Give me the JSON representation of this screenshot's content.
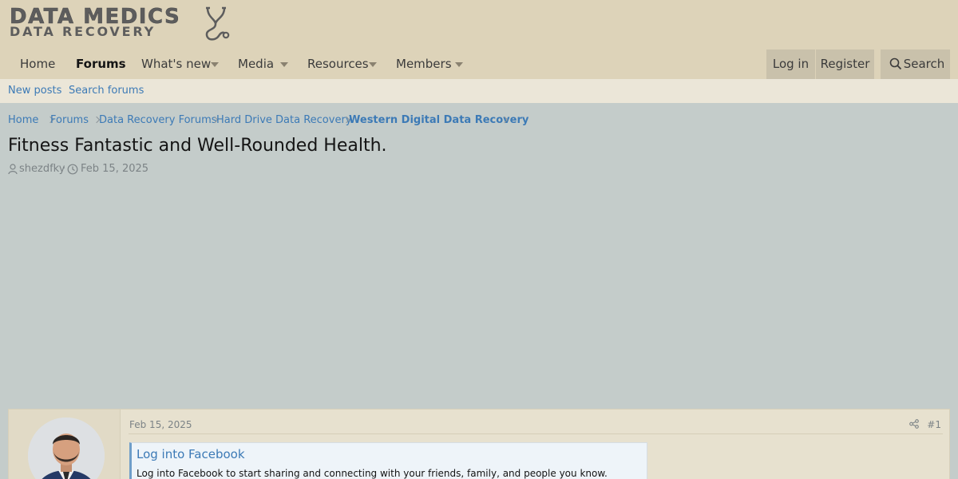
{
  "logo": {
    "line1": "DATA MEDICS",
    "line2": "DATA RECOVERY"
  },
  "nav": {
    "tabs": [
      {
        "label": "Home"
      },
      {
        "label": "Forums"
      },
      {
        "label": "What's new"
      },
      {
        "label": "Media"
      },
      {
        "label": "Resources"
      },
      {
        "label": "Members"
      }
    ],
    "login": "Log in",
    "register": "Register",
    "search": "Search"
  },
  "subnav": {
    "new_posts": "New posts",
    "search_forums": "Search forums"
  },
  "breadcrumb": [
    "Home",
    "Forums",
    "Data Recovery Forums",
    "Hard Drive Data Recovery",
    "Western Digital Data Recovery"
  ],
  "thread": {
    "title": "Fitness Fantastic and Well-Rounded Health.",
    "author": "shezdfky",
    "date": "Feb 15, 2025"
  },
  "post": {
    "date": "Feb 15, 2025",
    "number": "#1",
    "embed_title": "Log into Facebook",
    "embed_desc": "Log into Facebook to start sharing and connecting with your friends, family, and people you know."
  },
  "colors": {
    "header_bg": "#ddd3b9",
    "page_bg": "#c4ccca",
    "link": "#3c7ab6",
    "subnav_bg": "#ebe6d8"
  },
  "icons": [
    "stethoscope-icon",
    "search-icon",
    "user-icon",
    "clock-icon",
    "share-icon",
    "chevron-right-icon",
    "caret-down-icon"
  ]
}
